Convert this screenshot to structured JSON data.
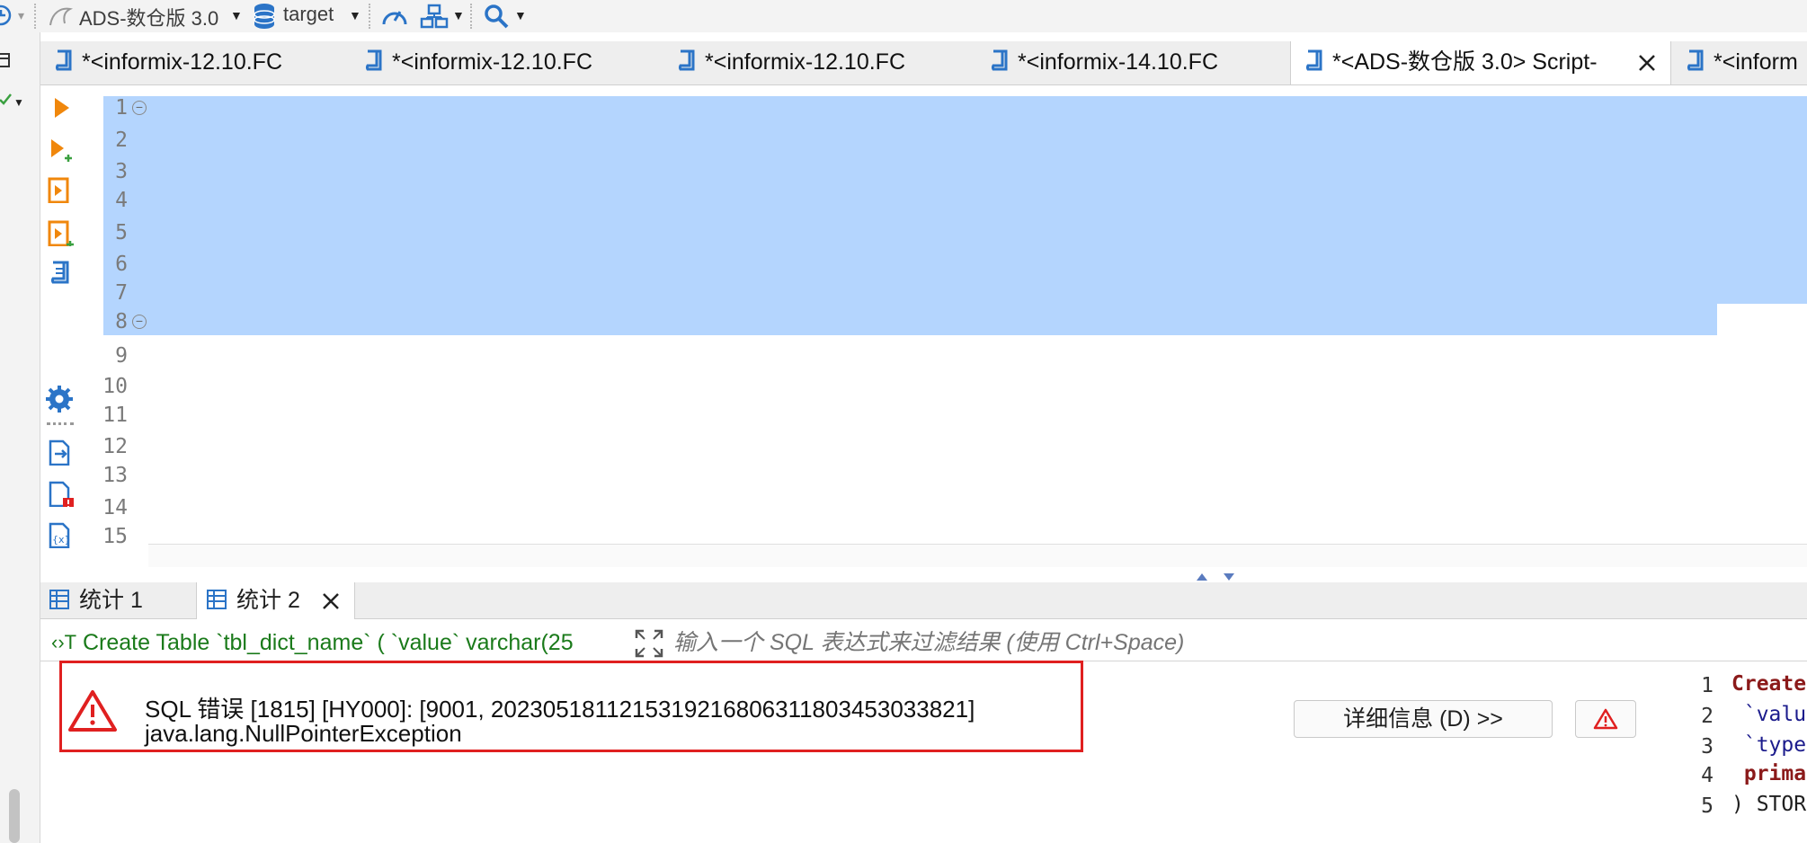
{
  "toolbar": {
    "connection_label": "ADS-数仓版 3.0",
    "database_label": "target"
  },
  "tabs": [
    {
      "label": "*<informix-12.10.FC"
    },
    {
      "label": "*<informix-12.10.FC"
    },
    {
      "label": "*<informix-12.10.FC"
    },
    {
      "label": "*<informix-14.10.FC"
    },
    {
      "label": "*<ADS-数仓版 3.0> Script-"
    },
    {
      "label": "*<inform"
    }
  ],
  "editor": {
    "line_numbers": [
      "1",
      "2",
      "3",
      "4",
      "5",
      "6",
      "7",
      "8",
      "9",
      "10",
      "11",
      "12",
      "13",
      "14",
      "15"
    ]
  },
  "results": {
    "tabs": [
      {
        "label": "统计 1"
      },
      {
        "label": "统计 2"
      }
    ],
    "query_preview": "Create Table `tbl_dict_name` ( `value` varchar(25",
    "filter_placeholder": "输入一个 SQL 表达式来过滤结果 (使用 Ctrl+Space)",
    "error_line1": "SQL 错误 [1815] [HY000]: [9001, 2023051811215319216806311803453033821]",
    "error_line2": "java.lang.NullPointerException",
    "details_button": "详细信息 (D) >>",
    "preview_line_numbers": [
      "1",
      "2",
      "3",
      "4",
      "5"
    ],
    "preview_lines": [
      "Create",
      " `valu",
      " `type",
      " prima",
      ") STOR"
    ]
  },
  "colors": {
    "selection": "#b4d5fe",
    "keyword": "#8b1a1a",
    "string": "#1a7a1a",
    "error_border": "#e02020",
    "icon_blue": "#2b74c7",
    "icon_orange": "#f0870c"
  }
}
